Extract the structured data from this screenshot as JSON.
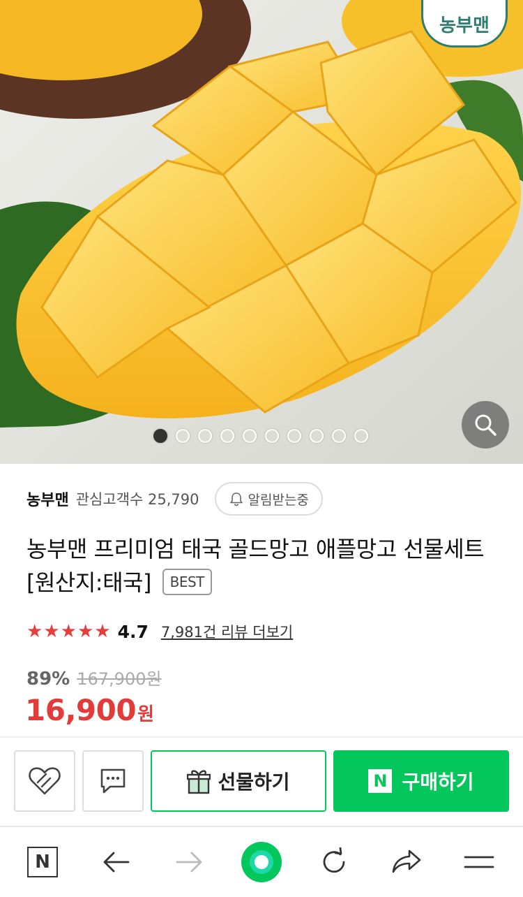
{
  "hero": {
    "brand_badge": "농부맨",
    "dots_total": 10,
    "dots_active_index": 0
  },
  "seller": {
    "name": "농부맨",
    "fans_label": "관심고객수 25,790",
    "notify_label": "알림받는중"
  },
  "product": {
    "title": "농부맨 프리미엄 태국 골드망고 애플망고 선물세트 [원산지:태국]",
    "badge": "BEST"
  },
  "rating": {
    "stars_value": 4.7,
    "score": "4.7",
    "review_link": "7,981건 리뷰 더보기"
  },
  "price": {
    "discount": "89%",
    "original": "167,900원",
    "sale": "16,900",
    "unit": "원"
  },
  "actions": {
    "gift_label": "선물하기",
    "buy_label": "구매하기",
    "npay_mark": "N"
  },
  "nav": {
    "home_mark": "N"
  },
  "colors": {
    "accent_green": "#03c75a",
    "price_red": "#e33a3a",
    "star_red": "#e63d3d",
    "brand_teal": "#2d7d70"
  },
  "icons": [
    "zoom-icon",
    "bell-icon",
    "heart-icon",
    "talk-icon",
    "gift-icon",
    "back-icon",
    "forward-icon",
    "refresh-icon",
    "share-icon",
    "menu-icon"
  ]
}
